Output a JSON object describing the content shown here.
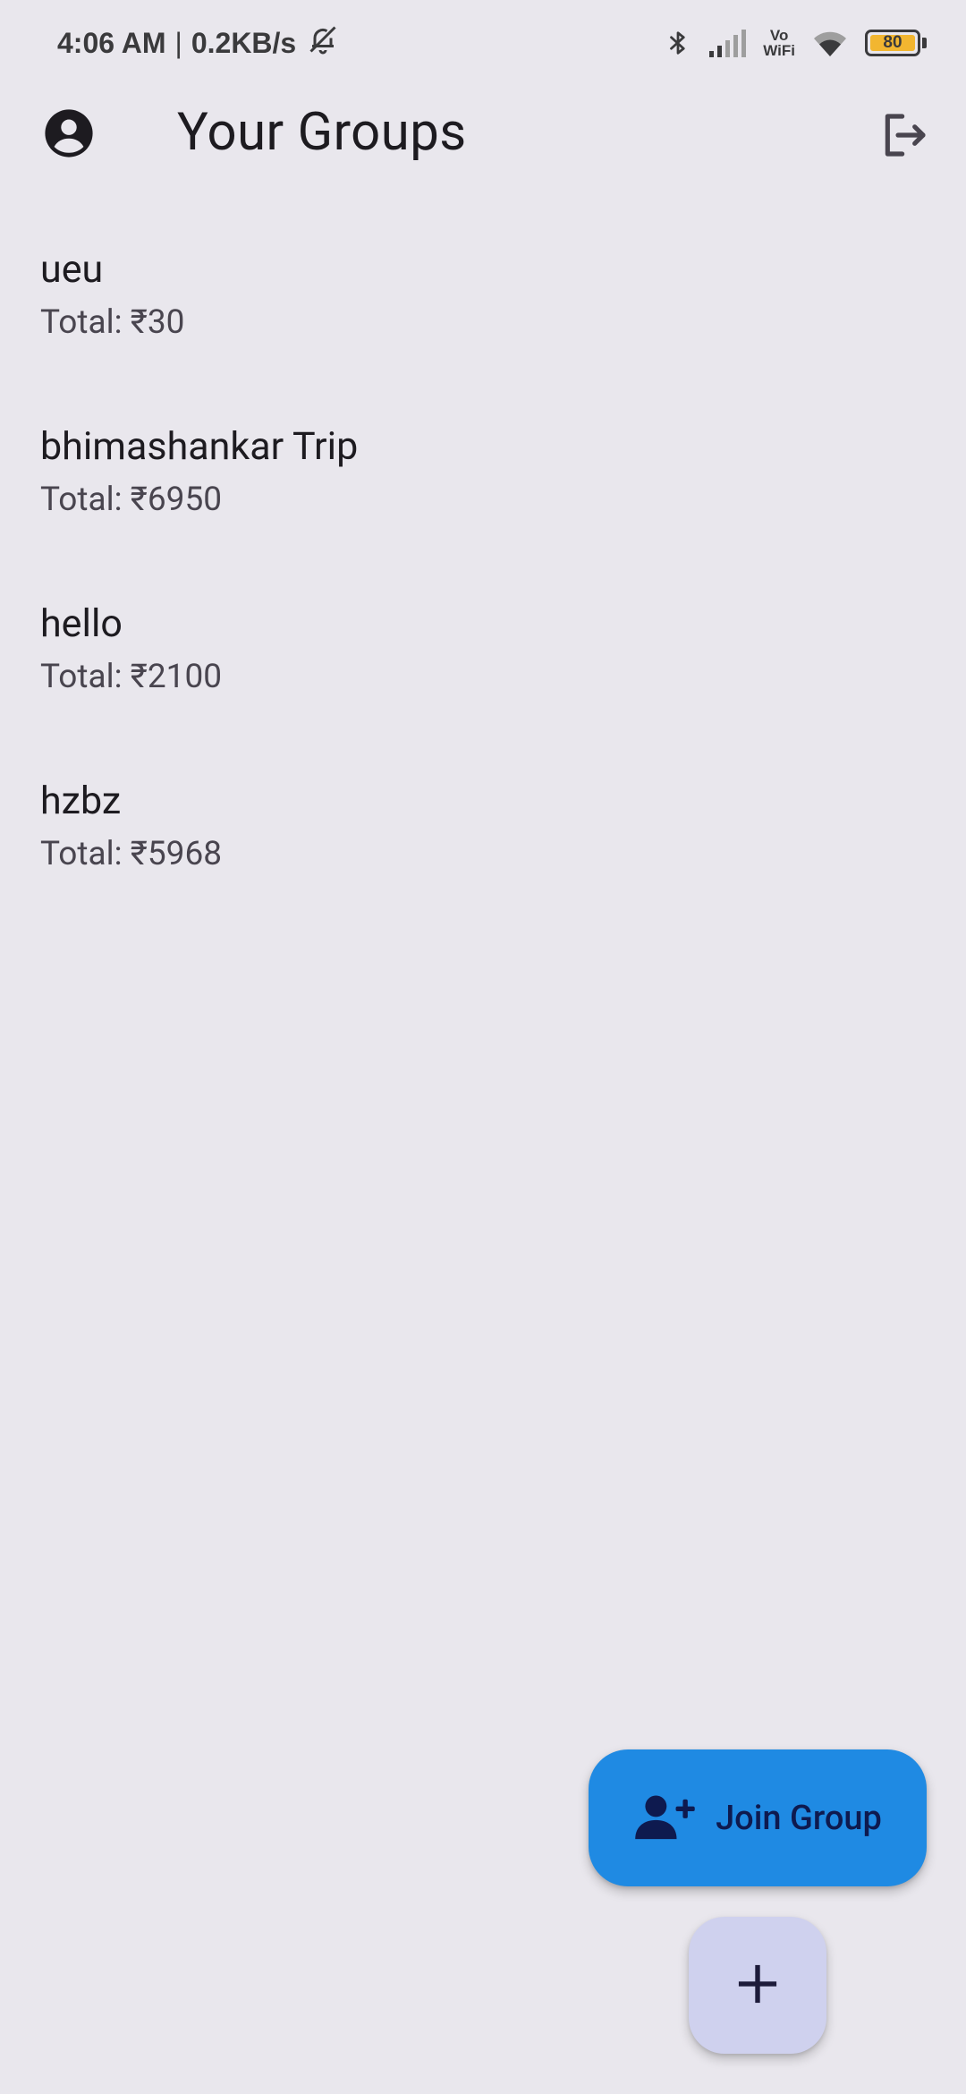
{
  "status_bar": {
    "time": "4:06 AM",
    "separator": "|",
    "network_speed": "0.2KB/s",
    "vowifi_top": "Vo",
    "vowifi_bottom": "WiFi",
    "battery_level": "80",
    "battery_color": "#f2b630"
  },
  "app_bar": {
    "title": "Your Groups",
    "profile_icon": "account-circle-icon",
    "logout_icon": "logout-icon"
  },
  "groups": [
    {
      "name": "ueu",
      "total": "Total: ₹30"
    },
    {
      "name": "bhimashankar Trip",
      "total": "Total: ₹6950"
    },
    {
      "name": "hello",
      "total": "Total: ₹2100"
    },
    {
      "name": "hzbz",
      "total": "Total: ₹5968"
    }
  ],
  "fab": {
    "join_label": "Join Group",
    "join_icon": "person-add-icon",
    "join_color": "#1f8ae3",
    "add_icon": "plus-icon",
    "add_color": "#cfd1ee"
  }
}
